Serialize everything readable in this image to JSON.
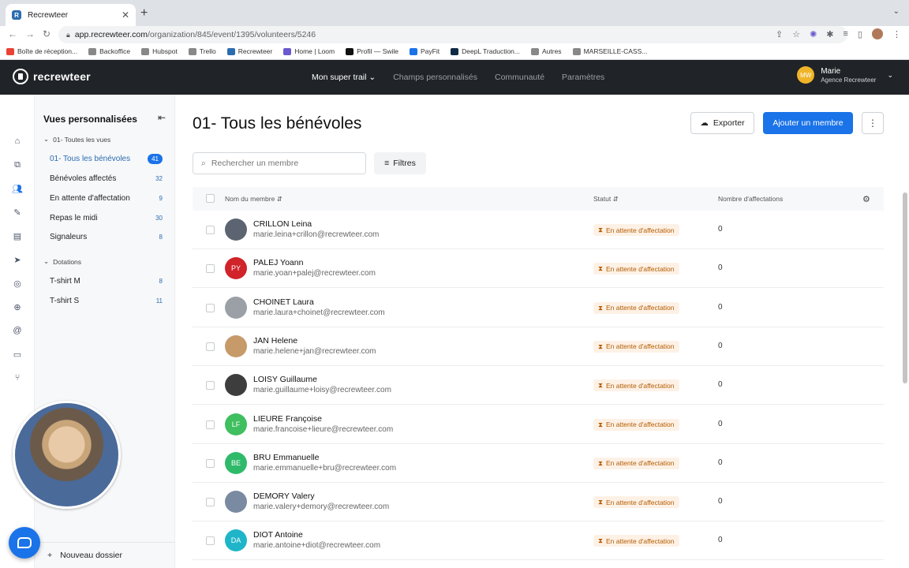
{
  "browser": {
    "tab_title": "Recrewteer",
    "url_host": "app.recrewteer.com",
    "url_path": "/organization/845/event/1395/volunteers/5246",
    "bookmarks": [
      {
        "label": "Boîte de réception...",
        "color": "#ea4335"
      },
      {
        "label": "Backoffice",
        "color": "#888888"
      },
      {
        "label": "Hubspot",
        "color": "#888888"
      },
      {
        "label": "Trello",
        "color": "#888888"
      },
      {
        "label": "Recrewteer",
        "color": "#2b6cb0"
      },
      {
        "label": "Home | Loom",
        "color": "#6a5acd"
      },
      {
        "label": "Profil — Swile",
        "color": "#111111"
      },
      {
        "label": "PayFit",
        "color": "#1a73e8"
      },
      {
        "label": "DeepL Traduction...",
        "color": "#0f2b46"
      },
      {
        "label": "Autres",
        "color": "#888888"
      },
      {
        "label": "MARSEILLE-CASS...",
        "color": "#888888"
      }
    ]
  },
  "app": {
    "logo_text": "recrewteer",
    "nav": [
      {
        "label": "Mon super trail",
        "active": true,
        "dropdown": true
      },
      {
        "label": "Champs personnalisés",
        "active": false
      },
      {
        "label": "Communauté",
        "active": false
      },
      {
        "label": "Paramètres",
        "active": false
      }
    ],
    "user": {
      "initials": "MW",
      "name": "Marie",
      "org": "Agence Recrewteer"
    }
  },
  "rail_icons": [
    "home-icon",
    "sitemap-icon",
    "users-icon",
    "magic-wand-icon",
    "document-icon",
    "send-icon",
    "check-circle-icon",
    "globe-icon",
    "at-icon",
    "folder-icon",
    "branch-icon"
  ],
  "sidebar": {
    "title": "Vues personnalisées",
    "groups": [
      {
        "label": "01- Toutes les vues",
        "items": [
          {
            "label": "01- Tous les bénévoles",
            "count": "41",
            "active": true
          },
          {
            "label": "Bénévoles affectés",
            "count": "32"
          },
          {
            "label": "En attente d'affectation",
            "count": "9"
          },
          {
            "label": "Repas le midi",
            "count": "30"
          },
          {
            "label": "Signaleurs",
            "count": "8"
          }
        ]
      },
      {
        "label": "Dotations",
        "items": [
          {
            "label": "T-shirt M",
            "count": "8"
          },
          {
            "label": "T-shirt S",
            "count": "11"
          }
        ]
      }
    ],
    "new_folder": "Nouveau dossier"
  },
  "main": {
    "title": "01- Tous les bénévoles",
    "export_label": "Exporter",
    "add_label": "Ajouter un membre",
    "search_placeholder": "Rechercher un membre",
    "filters_label": "Filtres",
    "columns": {
      "name": "Nom du membre",
      "status": "Statut",
      "assignments": "Nombre d'affectations"
    },
    "rows": [
      {
        "name": "CRILLON Leina",
        "email": "marie.leina+crillon@recrewteer.com",
        "status": "En attente d'affectation",
        "count": "0",
        "initials": "",
        "color": "#5b6470"
      },
      {
        "name": "PALEJ Yoann",
        "email": "marie.yoan+palej@recrewteer.com",
        "status": "En attente d'affectation",
        "count": "0",
        "initials": "PY",
        "color": "#d0232a"
      },
      {
        "name": "CHOINET Laura",
        "email": "marie.laura+choinet@recrewteer.com",
        "status": "En attente d'affectation",
        "count": "0",
        "initials": "",
        "color": "#9aa0a6"
      },
      {
        "name": "JAN Helene",
        "email": "marie.helene+jan@recrewteer.com",
        "status": "En attente d'affectation",
        "count": "0",
        "initials": "",
        "color": "#c79a6a"
      },
      {
        "name": "LOISY Guillaume",
        "email": "marie.guillaume+loisy@recrewteer.com",
        "status": "En attente d'affectation",
        "count": "0",
        "initials": "",
        "color": "#3d3d3d"
      },
      {
        "name": "LIEURE Françoise",
        "email": "marie.francoise+lieure@recrewteer.com",
        "status": "En attente d'affectation",
        "count": "0",
        "initials": "LF",
        "color": "#3fbf5f"
      },
      {
        "name": "BRU Emmanuelle",
        "email": "marie.emmanuelle+bru@recrewteer.com",
        "status": "En attente d'affectation",
        "count": "0",
        "initials": "BE",
        "color": "#2fba6a"
      },
      {
        "name": "DEMORY Valery",
        "email": "marie.valery+demory@recrewteer.com",
        "status": "En attente d'affectation",
        "count": "0",
        "initials": "",
        "color": "#7a8aa0"
      },
      {
        "name": "DIOT Antoine",
        "email": "marie.antoine+diot@recrewteer.com",
        "status": "En attente d'affectation",
        "count": "0",
        "initials": "DA",
        "color": "#1fb5c9"
      }
    ]
  }
}
